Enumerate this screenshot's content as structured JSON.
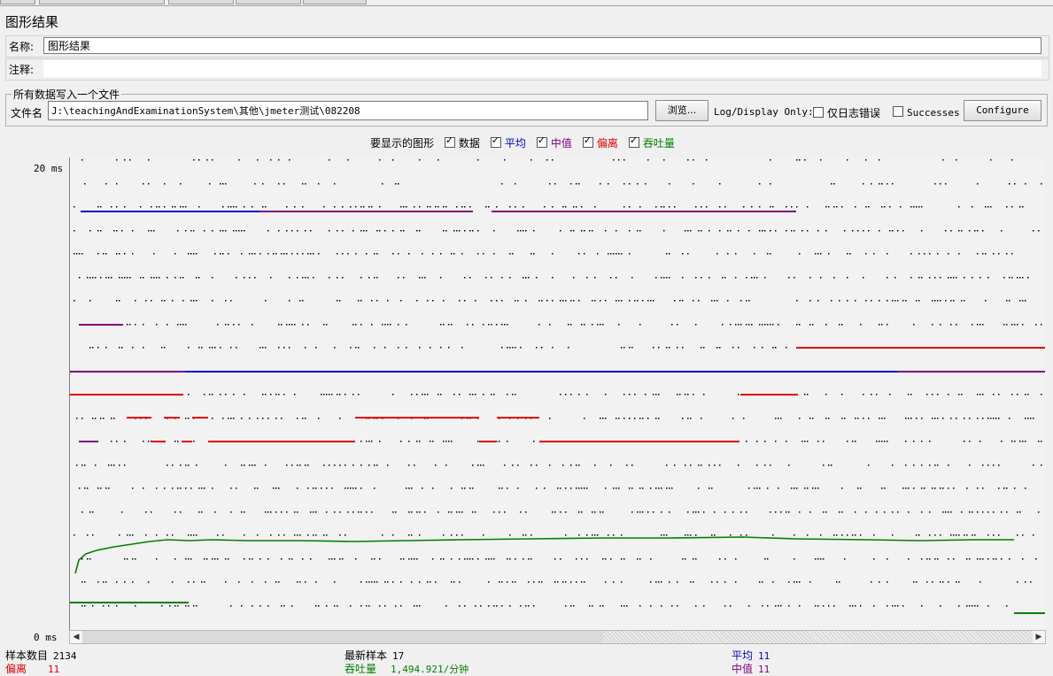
{
  "panel_title": "图形结果",
  "name_label": "名称:",
  "name_value": "图形结果",
  "comment_label": "注释:",
  "comment_value": "",
  "file_section": {
    "legend": "所有数据写入一个文件",
    "file_label": "文件名",
    "file_value": "J:\\teachingAndExaminationSystem\\其他\\jmeter测试\\082208",
    "browse_label": "浏览...",
    "log_display_label": "Log/Display Only:",
    "errors_label": "仅日志错误",
    "successes_label": "Successes",
    "configure_label": "Configure"
  },
  "display_options": {
    "label": "要显示的图形",
    "items": [
      {
        "label": "数据",
        "checked": true,
        "color": "#000000"
      },
      {
        "label": "平均",
        "checked": true,
        "color": "#0000cc"
      },
      {
        "label": "中值",
        "checked": true,
        "color": "#800080"
      },
      {
        "label": "偏离",
        "checked": true,
        "color": "#e00000"
      },
      {
        "label": "吞吐量",
        "checked": true,
        "color": "#008000"
      }
    ]
  },
  "chart_data": {
    "type": "scatter",
    "y_max_label": "20 ms",
    "y_min_label": "0 ms",
    "ylim": [
      0,
      20
    ],
    "grid": false,
    "series": [
      {
        "name": "数据",
        "color": "#000000"
      },
      {
        "name": "平均",
        "color": "#0000cc"
      },
      {
        "name": "中值",
        "color": "#800080"
      },
      {
        "name": "偏离",
        "color": "#e00000"
      },
      {
        "name": "吞吐量",
        "color": "#008000"
      }
    ]
  },
  "stats": {
    "samples_label": "样本数目",
    "samples_value": "2134",
    "latest_label": "最新样本",
    "latest_value": "17",
    "average_label": "平均",
    "average_value": "11",
    "deviation_label": "偏离",
    "deviation_value": "11",
    "throughput_label": "吞吐量",
    "throughput_value": "1,494.921/分钟",
    "median_label": "中值",
    "median_value": "11"
  },
  "colors": {
    "data": "#000000",
    "average": "#0000cc",
    "median": "#800080",
    "deviation": "#e00000",
    "throughput": "#008000"
  }
}
